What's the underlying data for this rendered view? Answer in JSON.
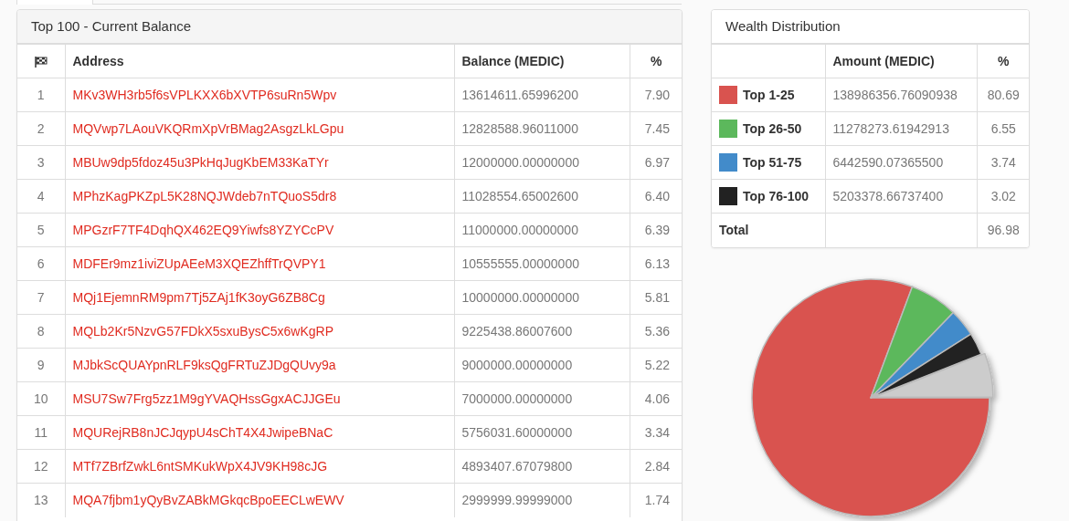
{
  "balance": {
    "title": "Top 100 - Current Balance",
    "columns": [
      "Address",
      "Balance (MEDIC)",
      "%"
    ],
    "rows": [
      {
        "rank": "1",
        "address": "MKv3WH3rb5f6sVPLKXX6bXVTP6suRn5Wpv",
        "balance": "13614611.65996200",
        "percent": "7.90"
      },
      {
        "rank": "2",
        "address": "MQVwp7LAouVKQRmXpVrBMag2AsgzLkLGpu",
        "balance": "12828588.96011000",
        "percent": "7.45"
      },
      {
        "rank": "3",
        "address": "MBUw9dp5fdoz45u3PkHqJugKbEM33KaTYr",
        "balance": "12000000.00000000",
        "percent": "6.97"
      },
      {
        "rank": "4",
        "address": "MPhzKagPKZpL5K28NQJWdeb7nTQuoS5dr8",
        "balance": "11028554.65002600",
        "percent": "6.40"
      },
      {
        "rank": "5",
        "address": "MPGzrF7TF4DqhQX462EQ9Yiwfs8YZYCcPV",
        "balance": "11000000.00000000",
        "percent": "6.39"
      },
      {
        "rank": "6",
        "address": "MDFEr9mz1iviZUpAEeM3XQEZhffTrQVPY1",
        "balance": "10555555.00000000",
        "percent": "6.13"
      },
      {
        "rank": "7",
        "address": "MQj1EjemnRM9pm7Tj5ZAj1fK3oyG6ZB8Cg",
        "balance": "10000000.00000000",
        "percent": "5.81"
      },
      {
        "rank": "8",
        "address": "MQLb2Kr5NzvG57FDkX5sxuBysC5x6wKgRP",
        "balance": "9225438.86007600",
        "percent": "5.36"
      },
      {
        "rank": "9",
        "address": "MJbkScQUAYpnRLF9ksQgFRTuZJDgQUvy9a",
        "balance": "9000000.00000000",
        "percent": "5.22"
      },
      {
        "rank": "10",
        "address": "MSU7Sw7Frg5zz1M9gYVAQHssGgxACJJGEu",
        "balance": "7000000.00000000",
        "percent": "4.06"
      },
      {
        "rank": "11",
        "address": "MQURejRB8nJCJqypU4sChT4X4JwipeBNaC",
        "balance": "5756031.60000000",
        "percent": "3.34"
      },
      {
        "rank": "12",
        "address": "MTf7ZBrfZwkL6ntSMKukWpX4JV9KH98cJG",
        "balance": "4893407.67079800",
        "percent": "2.84"
      },
      {
        "rank": "13",
        "address": "MQA7fjbm1yQyBvZABkMGkqcBpoEECLwEWV",
        "balance": "2999999.99999000",
        "percent": "1.74"
      }
    ]
  },
  "distribution": {
    "title": "Wealth Distribution",
    "columns": [
      "Amount (MEDIC)",
      "%"
    ],
    "rows": [
      {
        "label": "Top 1-25",
        "color": "#d9534f",
        "amount": "138986356.76090938",
        "percent": "80.69"
      },
      {
        "label": "Top 26-50",
        "color": "#5cb85c",
        "amount": "11278273.61942913",
        "percent": "6.55"
      },
      {
        "label": "Top 51-75",
        "color": "#428bca",
        "amount": "6442590.07365500",
        "percent": "3.74"
      },
      {
        "label": "Top 76-100",
        "color": "#222222",
        "amount": "5203378.66737400",
        "percent": "3.02"
      }
    ],
    "total": {
      "label": "Total",
      "percent": "96.98"
    },
    "chart_data": {
      "type": "pie",
      "values": [
        80.69,
        6.55,
        3.74,
        3.02,
        6.0
      ]
    }
  }
}
